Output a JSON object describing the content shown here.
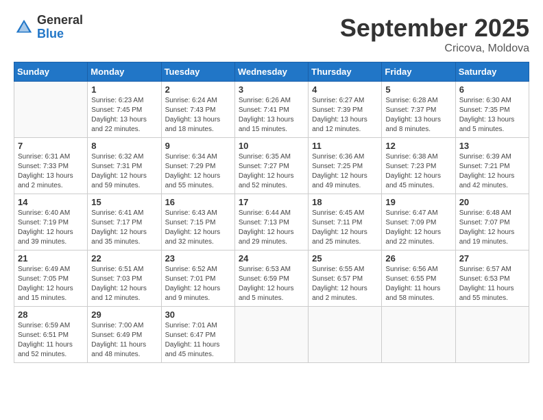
{
  "logo": {
    "general": "General",
    "blue": "Blue"
  },
  "header": {
    "title": "September 2025",
    "subtitle": "Cricova, Moldova"
  },
  "days_of_week": [
    "Sunday",
    "Monday",
    "Tuesday",
    "Wednesday",
    "Thursday",
    "Friday",
    "Saturday"
  ],
  "weeks": [
    [
      {
        "day": "",
        "info": ""
      },
      {
        "day": "1",
        "info": "Sunrise: 6:23 AM\nSunset: 7:45 PM\nDaylight: 13 hours and 22 minutes."
      },
      {
        "day": "2",
        "info": "Sunrise: 6:24 AM\nSunset: 7:43 PM\nDaylight: 13 hours and 18 minutes."
      },
      {
        "day": "3",
        "info": "Sunrise: 6:26 AM\nSunset: 7:41 PM\nDaylight: 13 hours and 15 minutes."
      },
      {
        "day": "4",
        "info": "Sunrise: 6:27 AM\nSunset: 7:39 PM\nDaylight: 13 hours and 12 minutes."
      },
      {
        "day": "5",
        "info": "Sunrise: 6:28 AM\nSunset: 7:37 PM\nDaylight: 13 hours and 8 minutes."
      },
      {
        "day": "6",
        "info": "Sunrise: 6:30 AM\nSunset: 7:35 PM\nDaylight: 13 hours and 5 minutes."
      }
    ],
    [
      {
        "day": "7",
        "info": "Sunrise: 6:31 AM\nSunset: 7:33 PM\nDaylight: 13 hours and 2 minutes."
      },
      {
        "day": "8",
        "info": "Sunrise: 6:32 AM\nSunset: 7:31 PM\nDaylight: 12 hours and 59 minutes."
      },
      {
        "day": "9",
        "info": "Sunrise: 6:34 AM\nSunset: 7:29 PM\nDaylight: 12 hours and 55 minutes."
      },
      {
        "day": "10",
        "info": "Sunrise: 6:35 AM\nSunset: 7:27 PM\nDaylight: 12 hours and 52 minutes."
      },
      {
        "day": "11",
        "info": "Sunrise: 6:36 AM\nSunset: 7:25 PM\nDaylight: 12 hours and 49 minutes."
      },
      {
        "day": "12",
        "info": "Sunrise: 6:38 AM\nSunset: 7:23 PM\nDaylight: 12 hours and 45 minutes."
      },
      {
        "day": "13",
        "info": "Sunrise: 6:39 AM\nSunset: 7:21 PM\nDaylight: 12 hours and 42 minutes."
      }
    ],
    [
      {
        "day": "14",
        "info": "Sunrise: 6:40 AM\nSunset: 7:19 PM\nDaylight: 12 hours and 39 minutes."
      },
      {
        "day": "15",
        "info": "Sunrise: 6:41 AM\nSunset: 7:17 PM\nDaylight: 12 hours and 35 minutes."
      },
      {
        "day": "16",
        "info": "Sunrise: 6:43 AM\nSunset: 7:15 PM\nDaylight: 12 hours and 32 minutes."
      },
      {
        "day": "17",
        "info": "Sunrise: 6:44 AM\nSunset: 7:13 PM\nDaylight: 12 hours and 29 minutes."
      },
      {
        "day": "18",
        "info": "Sunrise: 6:45 AM\nSunset: 7:11 PM\nDaylight: 12 hours and 25 minutes."
      },
      {
        "day": "19",
        "info": "Sunrise: 6:47 AM\nSunset: 7:09 PM\nDaylight: 12 hours and 22 minutes."
      },
      {
        "day": "20",
        "info": "Sunrise: 6:48 AM\nSunset: 7:07 PM\nDaylight: 12 hours and 19 minutes."
      }
    ],
    [
      {
        "day": "21",
        "info": "Sunrise: 6:49 AM\nSunset: 7:05 PM\nDaylight: 12 hours and 15 minutes."
      },
      {
        "day": "22",
        "info": "Sunrise: 6:51 AM\nSunset: 7:03 PM\nDaylight: 12 hours and 12 minutes."
      },
      {
        "day": "23",
        "info": "Sunrise: 6:52 AM\nSunset: 7:01 PM\nDaylight: 12 hours and 9 minutes."
      },
      {
        "day": "24",
        "info": "Sunrise: 6:53 AM\nSunset: 6:59 PM\nDaylight: 12 hours and 5 minutes."
      },
      {
        "day": "25",
        "info": "Sunrise: 6:55 AM\nSunset: 6:57 PM\nDaylight: 12 hours and 2 minutes."
      },
      {
        "day": "26",
        "info": "Sunrise: 6:56 AM\nSunset: 6:55 PM\nDaylight: 11 hours and 58 minutes."
      },
      {
        "day": "27",
        "info": "Sunrise: 6:57 AM\nSunset: 6:53 PM\nDaylight: 11 hours and 55 minutes."
      }
    ],
    [
      {
        "day": "28",
        "info": "Sunrise: 6:59 AM\nSunset: 6:51 PM\nDaylight: 11 hours and 52 minutes."
      },
      {
        "day": "29",
        "info": "Sunrise: 7:00 AM\nSunset: 6:49 PM\nDaylight: 11 hours and 48 minutes."
      },
      {
        "day": "30",
        "info": "Sunrise: 7:01 AM\nSunset: 6:47 PM\nDaylight: 11 hours and 45 minutes."
      },
      {
        "day": "",
        "info": ""
      },
      {
        "day": "",
        "info": ""
      },
      {
        "day": "",
        "info": ""
      },
      {
        "day": "",
        "info": ""
      }
    ]
  ]
}
